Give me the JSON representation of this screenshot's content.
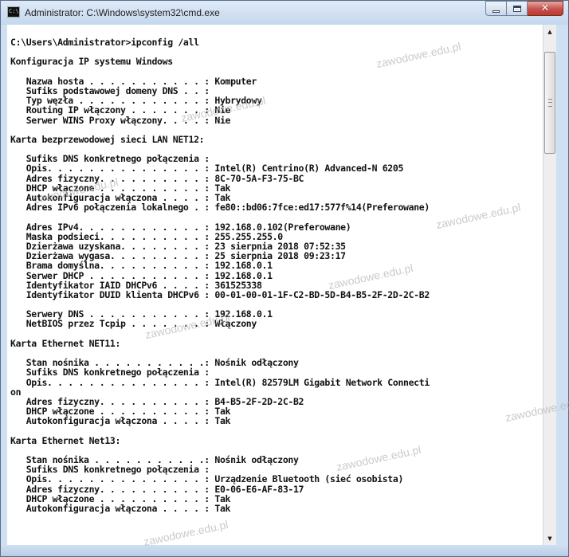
{
  "window": {
    "title": "Administrator: C:\\Windows\\system32\\cmd.exe",
    "icon_text": "C:\\",
    "controls": {
      "minimize": "minimize-icon",
      "maximize": "maximize-icon",
      "close": "close-icon",
      "close_glyph": "✕"
    }
  },
  "watermark": "zawodowe.edu.pl",
  "console_lines": [
    "C:\\Users\\Administrator>ipconfig /all",
    "",
    "Konfiguracja IP systemu Windows",
    "",
    "   Nazwa hosta . . . . . . . . . . . : Komputer",
    "   Sufiks podstawowej domeny DNS . . :",
    "   Typ węzła . . . . . . . . . . . . : Hybrydowy",
    "   Routing IP włączony . . . . . . . : Nie",
    "   Serwer WINS Proxy włączony. . . . : Nie",
    "",
    "Karta bezprzewodowej sieci LAN NET12:",
    "",
    "   Sufiks DNS konkretnego połączenia :",
    "   Opis. . . . . . . . . . . . . . . : Intel(R) Centrino(R) Advanced-N 6205",
    "   Adres fizyczny. . . . . . . . . . : 8C-70-5A-F3-75-BC",
    "   DHCP włączone . . . . . . . . . . : Tak",
    "   Autokonfiguracja włączona . . . . : Tak",
    "   Adres IPv6 połączenia lokalnego . : fe80::bd06:7fce:ed17:577f%14(Preferowane)",
    "",
    "   Adres IPv4. . . . . . . . . . . . : 192.168.0.102(Preferowane)",
    "   Maska podsieci. . . . . . . . . . : 255.255.255.0",
    "   Dzierżawa uzyskana. . . . . . . . : 23 sierpnia 2018 07:52:35",
    "   Dzierżawa wygasa. . . . . . . . . : 25 sierpnia 2018 09:23:17",
    "   Brama domyślna. . . . . . . . . . : 192.168.0.1",
    "   Serwer DHCP . . . . . . . . . . . : 192.168.0.1",
    "   Identyfikator IAID DHCPv6 . . . . : 361525338",
    "   Identyfikator DUID klienta DHCPv6 : 00-01-00-01-1F-C2-BD-5D-B4-B5-2F-2D-2C-B2",
    "",
    "   Serwery DNS . . . . . . . . . . . : 192.168.0.1",
    "   NetBIOS przez Tcpip . . . . . . . : Włączony",
    "",
    "Karta Ethernet NET11:",
    "",
    "   Stan nośnika . . . . . . . . . . .: Nośnik odłączony",
    "   Sufiks DNS konkretnego połączenia :",
    "   Opis. . . . . . . . . . . . . . . : Intel(R) 82579LM Gigabit Network Connecti",
    "on",
    "   Adres fizyczny. . . . . . . . . . : B4-B5-2F-2D-2C-B2",
    "   DHCP włączone . . . . . . . . . . : Tak",
    "   Autokonfiguracja włączona . . . . : Tak",
    "",
    "Karta Ethernet Net13:",
    "",
    "   Stan nośnika . . . . . . . . . . .: Nośnik odłączony",
    "   Sufiks DNS konkretnego połączenia :",
    "   Opis. . . . . . . . . . . . . . . : Urządzenie Bluetooth (sieć osobista)",
    "   Adres fizyczny. . . . . . . . . . : E0-06-E6-AF-83-17",
    "   DHCP włączone . . . . . . . . . . : Tak",
    "   Autokonfiguracja włączona . . . . : Tak"
  ],
  "scrollbar": {
    "up_arrow": "▲",
    "down_arrow": "▼"
  },
  "colors": {
    "console_bg": "#ffffff",
    "console_text": "#111111",
    "close_button": "#c75050"
  }
}
